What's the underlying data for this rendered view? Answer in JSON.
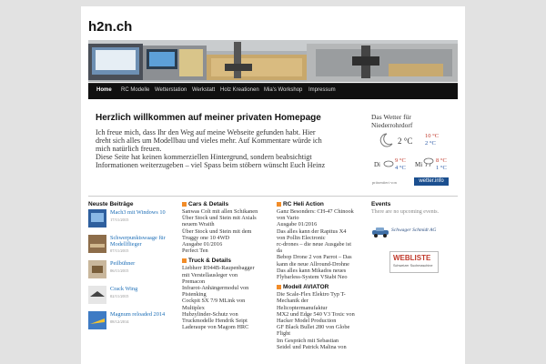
{
  "site": {
    "title": "h2n.ch"
  },
  "nav": {
    "items": [
      {
        "label": "Home"
      },
      {
        "label": "RC Modelle"
      },
      {
        "label": "Wetterstation"
      },
      {
        "label": "Werkstatt"
      },
      {
        "label": "Holz Kreationen"
      },
      {
        "label": "Mia's Workshop"
      },
      {
        "label": "Impressum"
      }
    ]
  },
  "welcome": {
    "title": "Herzlich willkommen auf meiner privaten Homepage",
    "lines": [
      "Ich freue mich, dass Ihr den Weg auf meine Webseite gefunden habt. Hier",
      "dreht sich alles um Modellbau und vieles mehr. Auf Kommentare würde ich",
      "mich natürlich freuen.",
      "Diese Seite hat keinen kommerziellen Hintergrund, sondern beabsichtigt",
      "Informationen weiterzugeben – viel Spass beim stöbern wünscht Euch Heinz"
    ]
  },
  "weather": {
    "title_line1": "Das Wetter für",
    "title_line2": "Niederrohrdorf",
    "now_temp": "2 °C",
    "now_high": "10 °C",
    "now_low": "2 °C",
    "days": [
      {
        "day": "Di",
        "high": "9 °C",
        "low": "4 °C"
      },
      {
        "day": "Mi",
        "high": "8 °C",
        "low": "1 °C"
      }
    ],
    "credit": "präsentiert von",
    "brand": "wetter.info",
    "colors": {
      "high": "#c0392b",
      "low": "#2a59a6"
    }
  },
  "columns": {
    "blog": {
      "title": "Neuste Beiträge",
      "items": [
        {
          "title": "Mach3 mit Windows 10",
          "date": "17/11/2015"
        },
        {
          "title": "Schwerpunktswaage für",
          "title2": "Modellflieger",
          "date": "07/11/2015"
        },
        {
          "title": "Peilbühner",
          "date": "06/11/2015"
        },
        {
          "title": "Crack Wing",
          "date": "02/11/2015"
        },
        {
          "title": "Magnum reloaded 2014",
          "date": "08/12/2014"
        }
      ]
    },
    "cars": {
      "title": "Cars & Details",
      "lines": [
        "Sanwas Colt mit allen Schikanen",
        "Über Stock und Stein mit Axials",
        "neuem Wraith",
        "Über Stock und Stein mit dem",
        "Truggy one 10 4WD",
        "Ausgabe 01/2016",
        "Perfect Ten"
      ]
    },
    "truck": {
      "title": "Truck & Details",
      "lines": [
        "Liebherr R944B-Raupenbagger",
        "mit Verstellausleger von",
        "Premacon",
        "Infrarot-Anhängermodul von",
        "Pistenking",
        "Cockpit SX 7/9 MLink von",
        "Multiplex",
        "Hubzylinder-Schutz von",
        "Truckmodelle Hendrik Seipt",
        "Laderaupe von Magom HRC"
      ]
    },
    "heli": {
      "title": "RC Heli Action",
      "lines": [
        "Ganz Besonders: CH-47 Chinook",
        "von Vario",
        "Ausgabe 01/2016",
        "Das alles kann der Rapitus X4",
        "von Pollin Electronic",
        "rc-drones – die neue Ausgabe ist",
        "da",
        "Bebop Drone 2 von Parrot – Das",
        "kann die neue Allround-Drohne",
        "Das alles kann Mikados neues",
        "Flybarless-System VStabi Neo"
      ]
    },
    "aviator": {
      "title": "Modell AVIATOR",
      "lines": [
        "Die Scale-Flex Elektro Typ T-",
        "Mechanik der",
        "Helicoptermanufaktur",
        "MX2 und Edge 540 V3 Toxic von",
        "Hacker Model Production",
        "GF Black Bullet 280 von Globe",
        "Flight",
        "Im Gespräch mit Sebastian",
        "Seidel und Patrick Malina von"
      ]
    },
    "events": {
      "title": "Events",
      "text": "There are no upcoming events.",
      "logo_text": "Schwager Schmidt AG",
      "webliste": "WEBLISTE",
      "webliste_sub": "Schweizer Suchmaschine"
    }
  }
}
